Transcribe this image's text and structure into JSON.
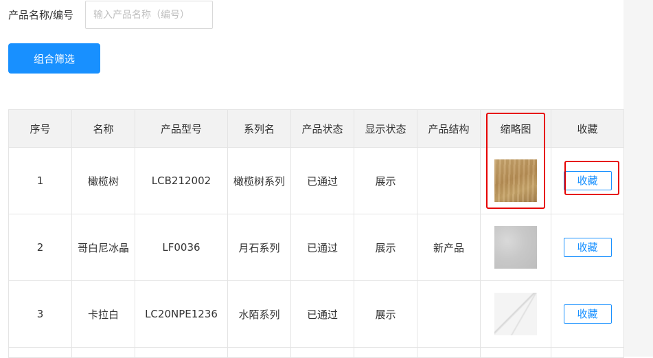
{
  "filter": {
    "label": "产品名称/编号",
    "placeholder": "输入产品名称（编号）",
    "button_label": "组合筛选"
  },
  "table": {
    "headers": [
      "序号",
      "名称",
      "产品型号",
      "系列名",
      "产品状态",
      "显示状态",
      "产品结构",
      "缩略图",
      "收藏"
    ],
    "rows": [
      {
        "index": "1",
        "name": "橄榄树",
        "model": "LCB212002",
        "series": "橄榄树系列",
        "status": "已通过",
        "display": "展示",
        "structure": "",
        "thumbnail": "wood-texture-thumbnail",
        "favorite_label": "收藏"
      },
      {
        "index": "2",
        "name": "哥白尼冰晶",
        "model": "LF0036",
        "series": "月石系列",
        "status": "已通过",
        "display": "展示",
        "structure": "新产品",
        "thumbnail": "gray-stone-thumbnail",
        "favorite_label": "收藏"
      },
      {
        "index": "3",
        "name": "卡拉白",
        "model": "LC20NPE1236",
        "series": "水陌系列",
        "status": "已通过",
        "display": "展示",
        "structure": "",
        "thumbnail": "white-marble-thumbnail",
        "favorite_label": "收藏"
      }
    ]
  },
  "colors": {
    "primary": "#1890ff",
    "header_bg": "#f2f2f2",
    "highlight": "#e60000"
  }
}
